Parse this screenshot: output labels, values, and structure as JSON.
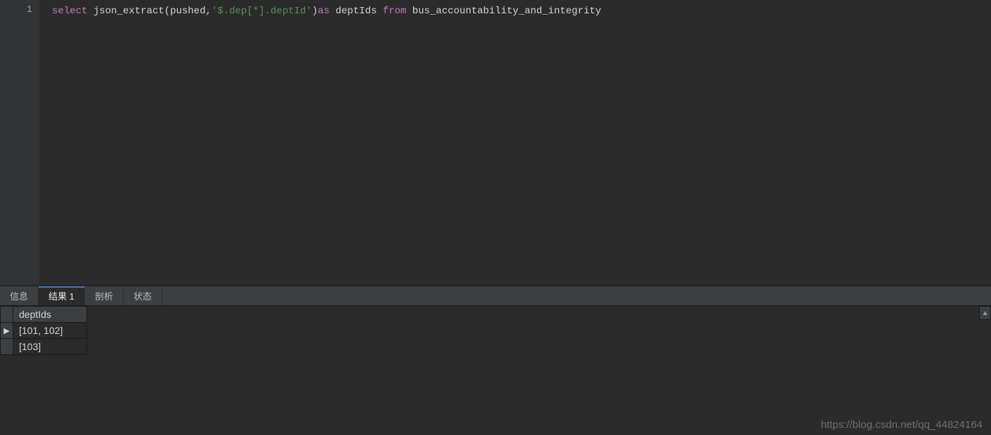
{
  "editor": {
    "lineNumber": "1",
    "tokens": {
      "select": "select",
      "func": "json_extract",
      "openParen": "(",
      "arg1": "pushed",
      "comma": ",",
      "str": "'$.dep[*].deptId'",
      "closeParen": ")",
      "as": "as",
      "alias": "deptIds",
      "from": "from",
      "table": "bus_accountability_and_integrity"
    }
  },
  "tabs": {
    "info": "信息",
    "result1": "结果 1",
    "profile": "剖析",
    "status": "状态"
  },
  "results": {
    "column": "deptIds",
    "rows": [
      "[101, 102]",
      "[103]"
    ],
    "currentRowMarker": "▶"
  },
  "scrollHint": "▲",
  "watermark": "https://blog.csdn.net/qq_44824164"
}
